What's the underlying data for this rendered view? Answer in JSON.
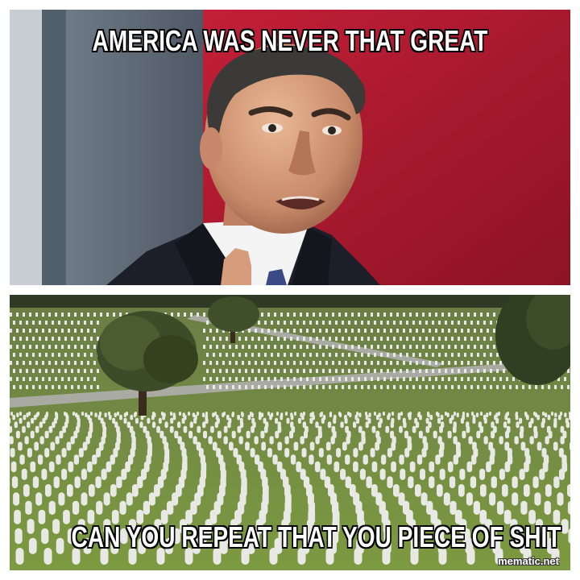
{
  "meme": {
    "top_caption": "AMERICA WAS NEVER THAT GREAT",
    "bottom_caption": "CAN YOU REPEAT THAT YOU PIECE OF SHIT",
    "watermark": "mematic.net"
  },
  "colors": {
    "background": "#ffffff",
    "top_backdrop_red": "#b0182c",
    "suit": "#1c1f2a",
    "grass": "#6f8a3a",
    "headstone": "#e8e8e4"
  },
  "icons": {
    "top_image": "man-speaking-photo",
    "bottom_image": "military-cemetery-photo"
  }
}
